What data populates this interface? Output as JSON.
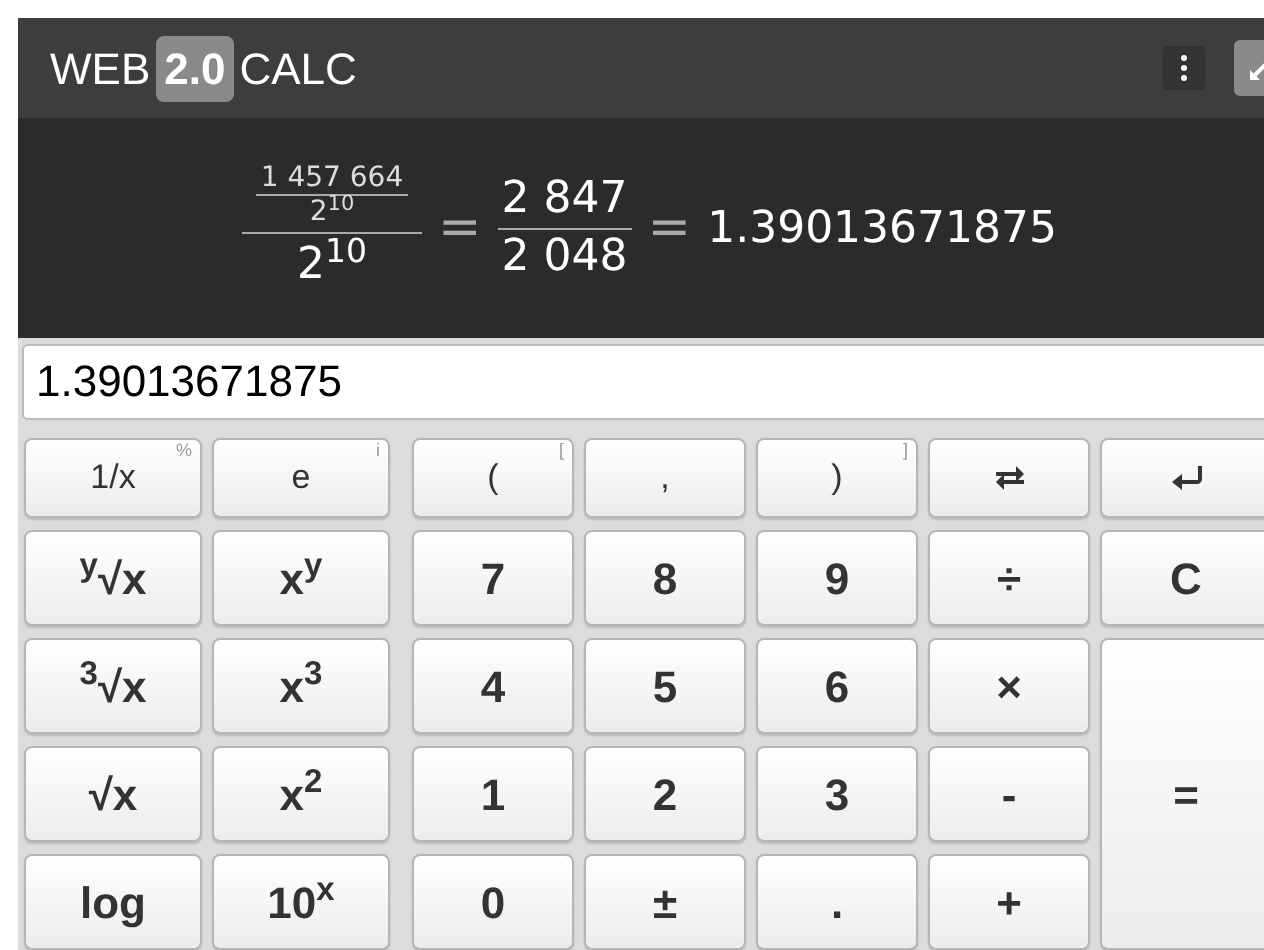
{
  "header": {
    "title_before": "WEB",
    "title_badge": "2.0",
    "title_after": "CALC"
  },
  "display": {
    "nested_numerator": "1 457 664",
    "nested_denominator": "2$^{10}$",
    "outer_denominator": "2$^{10}$",
    "equals_1": "=",
    "fraction_numerator": "2 847",
    "fraction_denominator": "2 048",
    "equals_2": "=",
    "result": "1.39013671875"
  },
  "input": {
    "value": "1.39013671875"
  },
  "left_keys": [
    {
      "label": "1/x",
      "hint": "%",
      "kind": "plain"
    },
    {
      "label": "e",
      "hint": "i",
      "kind": "plain"
    },
    {
      "label": "$^{y}$√x",
      "kind": "bold"
    },
    {
      "label": "x$^{y}$",
      "kind": "bold"
    },
    {
      "label": "$^{3}$√x",
      "kind": "bold"
    },
    {
      "label": "x$^{3}$",
      "kind": "bold"
    },
    {
      "label": "√x",
      "kind": "bold"
    },
    {
      "label": "x$^{2}$",
      "kind": "bold"
    },
    {
      "label": "log",
      "kind": "bold"
    },
    {
      "label": "10$^{x}$",
      "kind": "bold"
    }
  ],
  "right_keys": [
    {
      "label": "(",
      "hint": "[",
      "kind": "plain"
    },
    {
      "label": ",",
      "kind": "plain"
    },
    {
      "label": ")",
      "hint": "]",
      "kind": "plain"
    },
    {
      "kind": "swap"
    },
    {
      "kind": "enter"
    },
    {
      "label": "7",
      "kind": "bold"
    },
    {
      "label": "8",
      "kind": "bold"
    },
    {
      "label": "9",
      "kind": "bold"
    },
    {
      "label": "÷",
      "kind": "bold"
    },
    {
      "label": "C",
      "kind": "bold"
    },
    {
      "label": "4",
      "kind": "bold"
    },
    {
      "label": "5",
      "kind": "bold"
    },
    {
      "label": "6",
      "kind": "bold"
    },
    {
      "label": "×",
      "kind": "bold"
    },
    {
      "label": "1",
      "kind": "bold"
    },
    {
      "label": "2",
      "kind": "bold"
    },
    {
      "label": "3",
      "kind": "bold"
    },
    {
      "label": "-",
      "kind": "bold"
    },
    {
      "label": "0",
      "kind": "bold"
    },
    {
      "label": "±",
      "kind": "bold"
    },
    {
      "label": ".",
      "kind": "bold"
    },
    {
      "label": "+",
      "kind": "bold"
    },
    {
      "label": "=",
      "kind": "bold",
      "tall": true
    }
  ]
}
